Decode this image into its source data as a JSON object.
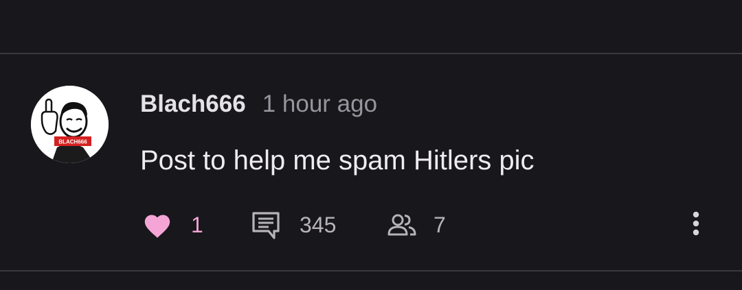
{
  "comment": {
    "username": "Blach666",
    "timestamp": "1 hour ago",
    "text": "Post to help me spam Hitlers pic",
    "avatar_label": "BLACH666"
  },
  "actions": {
    "likes": "1",
    "comments": "345",
    "participants": "7"
  },
  "icons": {
    "like": "heart-icon",
    "comments": "comment-icon",
    "participants": "people-icon",
    "more": "more-vertical-icon"
  },
  "colors": {
    "background": "#18171c",
    "divider": "#3a393f",
    "heart": "#f4a5d6",
    "muted": "#97959d"
  }
}
